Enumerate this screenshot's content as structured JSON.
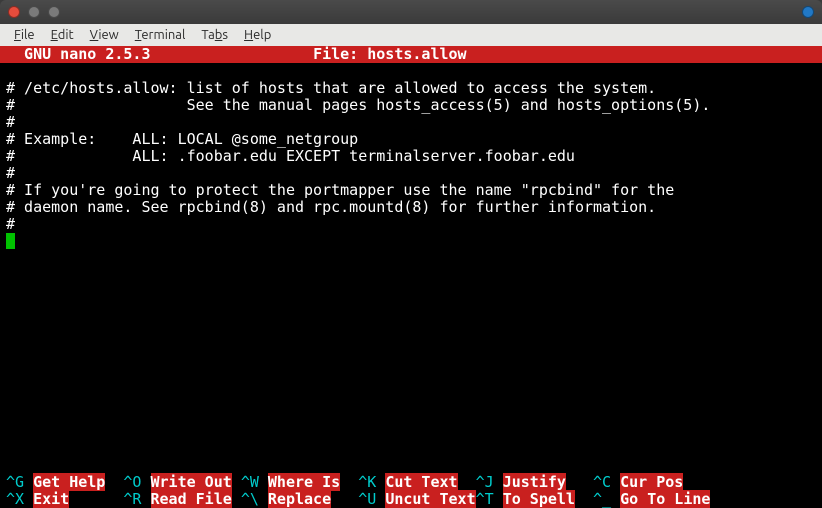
{
  "window": {
    "menus": [
      "File",
      "Edit",
      "View",
      "Terminal",
      "Tabs",
      "Help"
    ]
  },
  "nano": {
    "app": "GNU nano 2.5.3",
    "file_label": "File:",
    "filename": "hosts.allow",
    "header_left": "  GNU nano 2.5.3",
    "header_center": "File: hosts.allow"
  },
  "file_lines": [
    "# /etc/hosts.allow: list of hosts that are allowed to access the system.",
    "#                   See the manual pages hosts_access(5) and hosts_options(5).",
    "#",
    "# Example:    ALL: LOCAL @some_netgroup",
    "#             ALL: .foobar.edu EXCEPT terminalserver.foobar.edu",
    "#",
    "# If you're going to protect the portmapper use the name \"rpcbind\" for the",
    "# daemon name. See rpcbind(8) and rpc.mountd(8) for further information.",
    "#"
  ],
  "shortcuts": {
    "row1": [
      {
        "key": "^G",
        "label": "Get Help"
      },
      {
        "key": "^O",
        "label": "Write Out"
      },
      {
        "key": "^W",
        "label": "Where Is"
      },
      {
        "key": "^K",
        "label": "Cut Text"
      },
      {
        "key": "^J",
        "label": "Justify"
      },
      {
        "key": "^C",
        "label": "Cur Pos"
      }
    ],
    "row2": [
      {
        "key": "^X",
        "label": "Exit"
      },
      {
        "key": "^R",
        "label": "Read File"
      },
      {
        "key": "^\\",
        "label": "Replace"
      },
      {
        "key": "^U",
        "label": "Uncut Text"
      },
      {
        "key": "^T",
        "label": "To Spell"
      },
      {
        "key": "^_",
        "label": "Go To Line"
      }
    ]
  }
}
